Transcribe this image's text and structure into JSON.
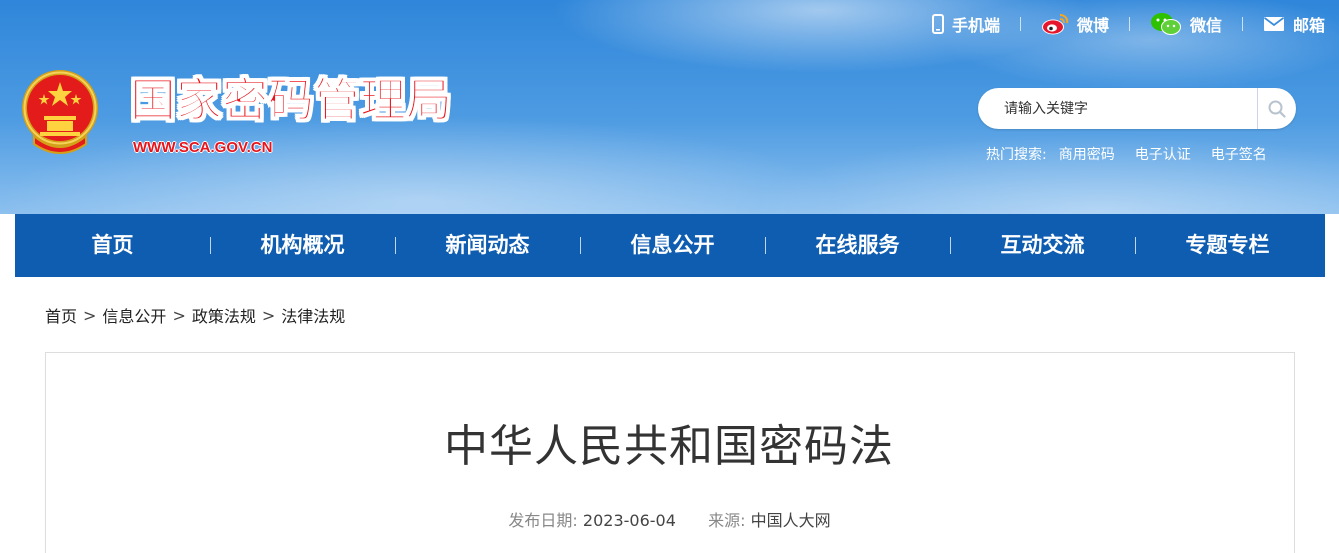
{
  "toplinks": [
    {
      "label": "手机端",
      "icon": "mobile-icon"
    },
    {
      "label": "微博",
      "icon": "weibo-icon"
    },
    {
      "label": "微信",
      "icon": "wechat-icon"
    },
    {
      "label": "邮箱",
      "icon": "mail-icon"
    }
  ],
  "site": {
    "title": "国家密码管理局",
    "url": "WWW.SCA.GOV.CN",
    "emblem": "national-emblem-icon"
  },
  "search": {
    "placeholder": "请输入关键字",
    "hot_label": "热门搜索:",
    "hot_keywords": [
      "商用密码",
      "电子认证",
      "电子签名"
    ]
  },
  "nav": [
    "首页",
    "机构概况",
    "新闻动态",
    "信息公开",
    "在线服务",
    "互动交流",
    "专题专栏"
  ],
  "breadcrumb": [
    "首页",
    "信息公开",
    "政策法规",
    "法律法规"
  ],
  "article": {
    "title": "中华人民共和国密码法",
    "date_label": "发布日期:",
    "date": "2023-06-04",
    "source_label": "来源:",
    "source": "中国人大网"
  },
  "colors": {
    "nav_bg": "#0f5db1",
    "title_red": "#e8141c",
    "sky_blue": "#3a8ddc"
  }
}
